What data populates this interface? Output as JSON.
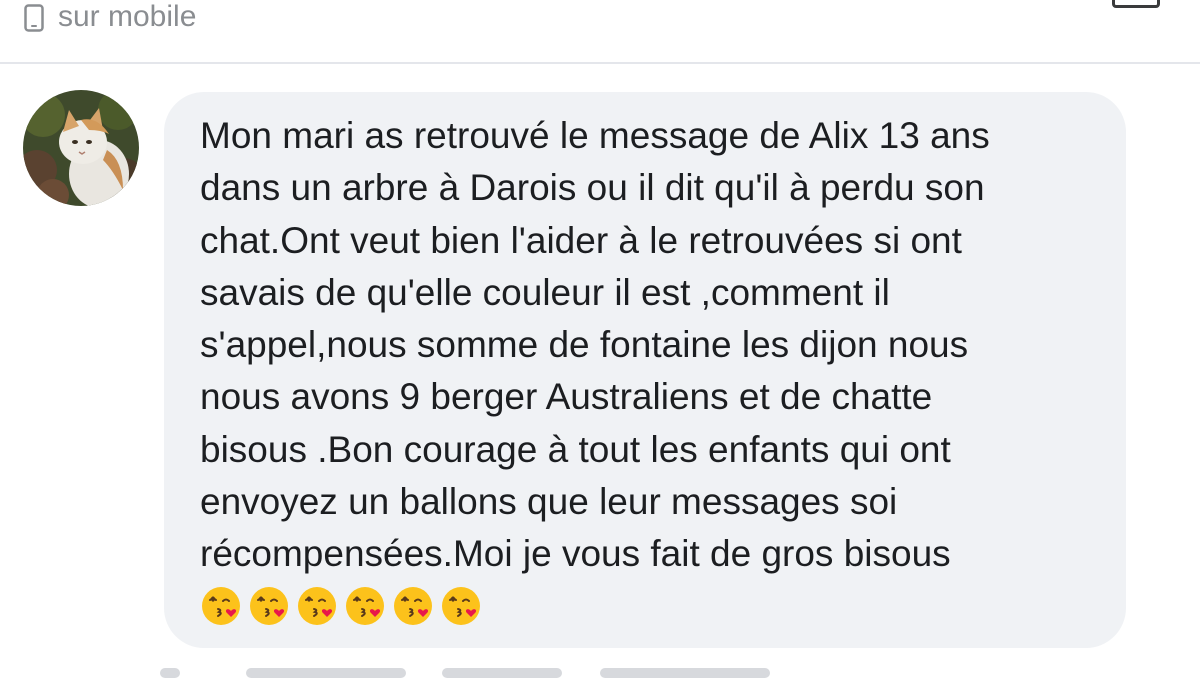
{
  "header": {
    "mobile_label": "sur mobile",
    "icons": [
      "mobile-phone-icon",
      "options-icon"
    ]
  },
  "message": {
    "lines": [
      "Mon mari as retrouvé le message de Alix 13 ans",
      "dans un arbre à Darois ou il dit qu'il à perdu son",
      "chat.Ont veut bien l'aider à le retrouvées si ont",
      "savais de qu'elle couleur il est ,comment il",
      "s'appel,nous somme de fontaine les dijon nous",
      "nous avons 9 berger Australiens et de chatte",
      "bisous .Bon courage à tout les enfants qui ont",
      "envoyez un ballons que leur messages soi",
      "récompensées.Moi je vous fait de gros bisous"
    ],
    "emoji": "kissing-face-with-heart-icon",
    "emoji_count": 6
  },
  "colors": {
    "bubble_bg": "#f0f2f5",
    "text": "#1c1e21",
    "muted": "#8a8d91",
    "emoji_face": "#fcc21b",
    "heart": "#e8174a"
  }
}
